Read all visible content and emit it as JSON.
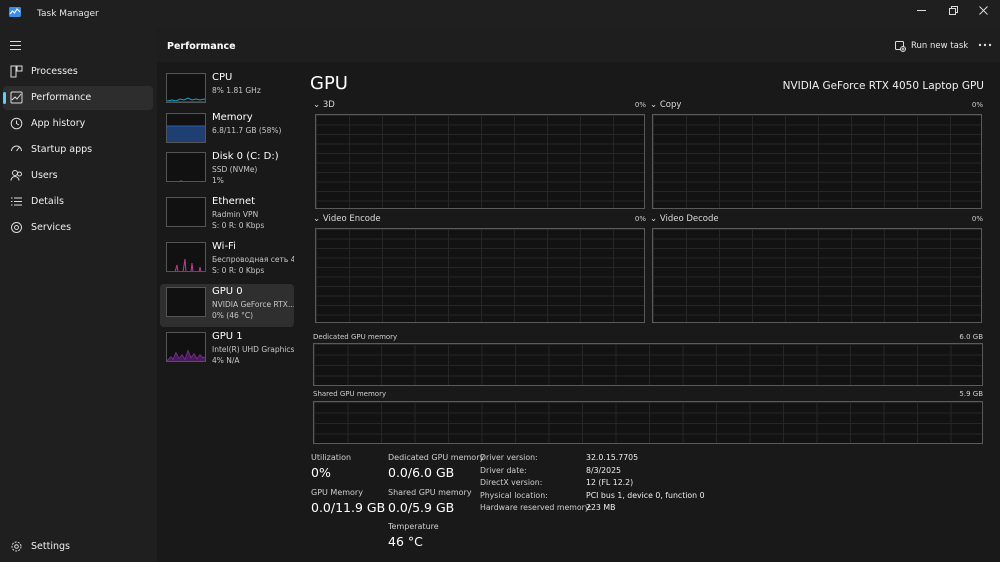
{
  "window": {
    "title": "Task Manager"
  },
  "sidebar": {
    "items": [
      {
        "label": "Processes",
        "icon": "processes-icon"
      },
      {
        "label": "Performance",
        "icon": "performance-icon",
        "active": true
      },
      {
        "label": "App history",
        "icon": "app-history-icon"
      },
      {
        "label": "Startup apps",
        "icon": "startup-apps-icon"
      },
      {
        "label": "Users",
        "icon": "users-icon"
      },
      {
        "label": "Details",
        "icon": "details-icon"
      },
      {
        "label": "Services",
        "icon": "services-icon"
      }
    ],
    "settings_label": "Settings"
  },
  "header": {
    "section_title": "Performance",
    "run_new_task_label": "Run new task"
  },
  "devices": [
    {
      "name": "CPU",
      "line1": "8% 1.81 GHz",
      "line2": ""
    },
    {
      "name": "Memory",
      "line1": "6.8/11.7 GB (58%)",
      "line2": ""
    },
    {
      "name": "Disk 0 (C: D:)",
      "line1": "SSD (NVMe)",
      "line2": "1%"
    },
    {
      "name": "Ethernet",
      "line1": "Radmin VPN",
      "line2": "S: 0 R: 0 Kbps"
    },
    {
      "name": "Wi-Fi",
      "line1": "Беспроводная сеть 4",
      "line2": "S: 0 R: 0 Kbps"
    },
    {
      "name": "GPU 0",
      "line1": "NVIDIA GeForce RTX...",
      "line2": "0% (46 °C)",
      "active": true
    },
    {
      "name": "GPU 1",
      "line1": "Intel(R) UHD Graphics",
      "line2": "4% N/A"
    }
  ],
  "detail": {
    "title": "GPU",
    "model": "NVIDIA GeForce RTX 4050 Laptop GPU",
    "engines": [
      {
        "label": "3D",
        "percent": "0%"
      },
      {
        "label": "Copy",
        "percent": "0%"
      },
      {
        "label": "Video Encode",
        "percent": "0%"
      },
      {
        "label": "Video Decode",
        "percent": "0%"
      }
    ],
    "dedicated_memory_label": "Dedicated GPU memory",
    "dedicated_memory_max": "6.0 GB",
    "shared_memory_label": "Shared GPU memory",
    "shared_memory_max": "5.9 GB"
  },
  "stats": {
    "utilization_label": "Utilization",
    "utilization_value": "0%",
    "dedicated_label": "Dedicated GPU memory",
    "dedicated_value": "0.0/6.0 GB",
    "gpu_memory_label": "GPU Memory",
    "gpu_memory_value": "0.0/11.9 GB",
    "shared_label": "Shared GPU memory",
    "shared_value": "0.0/5.9 GB",
    "temperature_label": "Temperature",
    "temperature_value": "46 °C"
  },
  "info": [
    {
      "key": "Driver version:",
      "value": "32.0.15.7705"
    },
    {
      "key": "Driver date:",
      "value": "8/3/2025"
    },
    {
      "key": "DirectX version:",
      "value": "12 (FL 12.2)"
    },
    {
      "key": "Physical location:",
      "value": "PCI bus 1, device 0, function 0"
    },
    {
      "key": "Hardware reserved memory:",
      "value": "223 MB"
    }
  ],
  "colors": {
    "accent": "#60cdff",
    "cpu_graph": "#17a2c9",
    "memory_graph": "#2a5ca8",
    "disk_graph": "#58a83a",
    "wifi_graph": "#c0399a",
    "gpu1_graph": "#a13bc2"
  }
}
